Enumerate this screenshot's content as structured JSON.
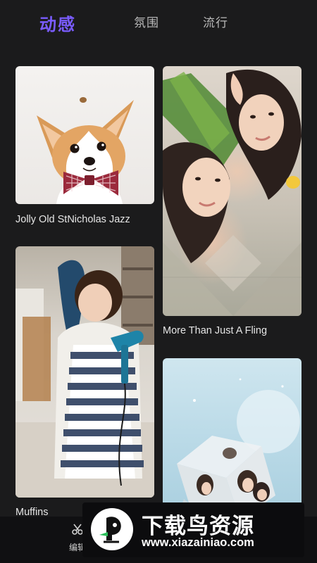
{
  "tabs": [
    {
      "label": "动感",
      "active": true
    },
    {
      "label": "氛围",
      "active": false
    },
    {
      "label": "流行",
      "active": false
    }
  ],
  "cards": [
    {
      "title": "Jolly Old StNicholas Jazz",
      "image": "corgi-with-bowtie"
    },
    {
      "title": "More Than Just A Fling",
      "image": "two-women-lying-on-mat"
    },
    {
      "title": "Muffins",
      "image": "woman-with-hairdryer"
    },
    {
      "title": "",
      "image": "photo-cube-collage"
    }
  ],
  "bottom_nav": {
    "edit_label": "编辑",
    "edit_icon": "scissors-icon"
  },
  "watermark": {
    "title": "下载鸟资源",
    "url": "www.xiazainiao.com"
  },
  "colors": {
    "background": "#1b1b1c",
    "accent": "#7a5cff",
    "tab_inactive": "#b9b9b9"
  }
}
